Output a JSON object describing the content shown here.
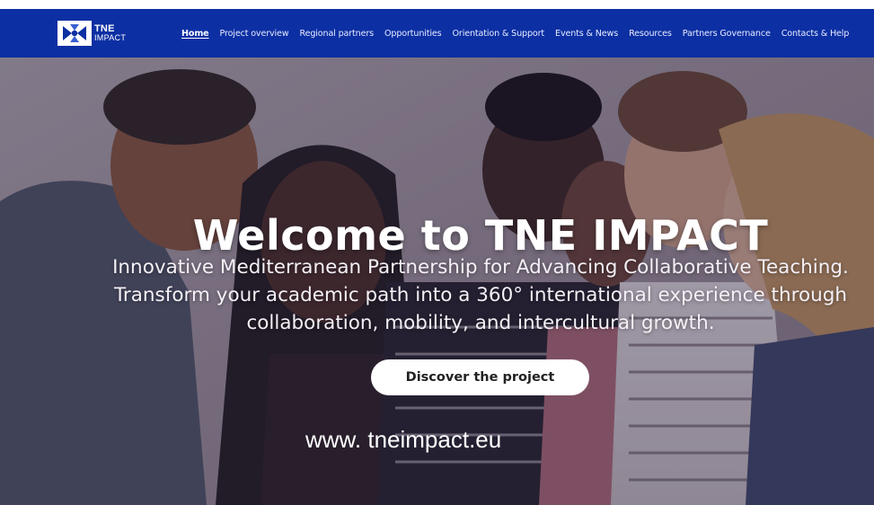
{
  "logo": {
    "line1": "TNE",
    "line2": "IMPACT"
  },
  "nav": {
    "items": [
      {
        "label": "Home",
        "active": true
      },
      {
        "label": "Project overview",
        "active": false
      },
      {
        "label": "Regional partners",
        "active": false
      },
      {
        "label": "Opportunities",
        "active": false
      },
      {
        "label": "Orientation & Support",
        "active": false
      },
      {
        "label": "Events & News",
        "active": false
      },
      {
        "label": "Resources",
        "active": false
      },
      {
        "label": "Partners Governance",
        "active": false
      },
      {
        "label": "Contacts & Help",
        "active": false
      }
    ]
  },
  "hero": {
    "title": "Welcome to TNE IMPACT",
    "subtitle_line1": "Innovative Mediterranean Partnership for Advancing Collaborative Teaching.",
    "subtitle_line2": "Transform your academic path into a 360° international experience through",
    "subtitle_line3": "collaboration, mobility, and intercultural growth.",
    "cta_label": "Discover the project",
    "url_text": "www. tneimpact.eu"
  },
  "colors": {
    "navbar": "#0c2fa3",
    "cta_bg": "#ffffff",
    "text_light": "#ffffff"
  },
  "icons": {
    "logo_mark": "tne-logo-icon"
  }
}
